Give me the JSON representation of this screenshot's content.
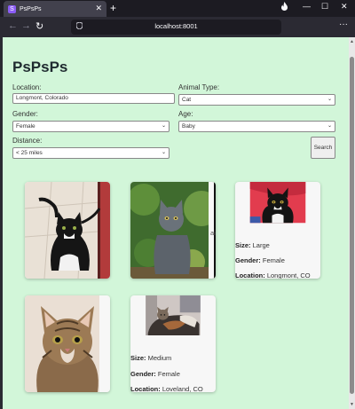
{
  "browser": {
    "tab_title": "PsPsPs",
    "favicon_letter": "S",
    "url": "localhost:8001"
  },
  "page": {
    "title": "PsPsPs",
    "location": {
      "label": "Location:",
      "value": "Longmont, Colorado"
    },
    "animal_type": {
      "label": "Animal Type:",
      "value": "Cat"
    },
    "gender": {
      "label": "Gender:",
      "value": "Female"
    },
    "age": {
      "label": "Age:",
      "value": "Baby"
    },
    "distance": {
      "label": "Distance:",
      "value": "< 25 miles"
    },
    "search_label": "Search"
  },
  "cards": [
    {
      "photo": "black-white-cat-photo"
    },
    {
      "photo": "gray-cat-photo",
      "overflow_text": "air"
    },
    {
      "photo": "tuxedo-cat-photo",
      "size_label": "Size:",
      "size_value": "Large",
      "gender_label": "Gender:",
      "gender_value": "Female",
      "location_label": "Location:",
      "location_value": "Longmont, CO"
    },
    {
      "photo": "tabby-kitten-photo"
    },
    {
      "photo": "calico-cat-photo",
      "size_label": "Size:",
      "size_value": "Medium",
      "gender_label": "Gender:",
      "gender_value": "Female",
      "location_label": "Location:",
      "location_value": "Loveland, CO"
    }
  ]
}
